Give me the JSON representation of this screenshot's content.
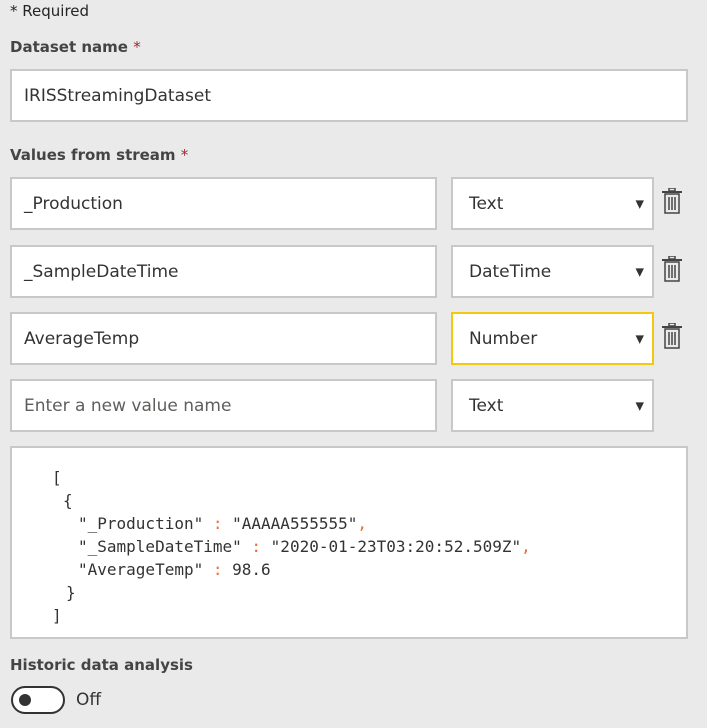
{
  "required_note": {
    "star": "*",
    "text": " Required"
  },
  "dataset": {
    "label": "Dataset name",
    "required_star": "*",
    "value": "IRISStreamingDataset"
  },
  "values_section": {
    "label": "Values from stream",
    "required_star": "*",
    "rows": [
      {
        "name": "_Production",
        "type": "Text",
        "deletable": true
      },
      {
        "name": "_SampleDateTime",
        "type": "DateTime",
        "deletable": true
      },
      {
        "name": "AverageTemp",
        "type": "Number",
        "deletable": true,
        "focused": true
      }
    ],
    "new_row": {
      "placeholder": "Enter a new value name",
      "type": "Text"
    }
  },
  "json_preview": {
    "open_bracket": "[",
    "open_brace": "{",
    "lines": [
      {
        "key": "\"_Production\"",
        "sep": " : ",
        "value": "\"AAAAA555555\"",
        "comma": ","
      },
      {
        "key": "\"_SampleDateTime\"",
        "sep": " : ",
        "value": "\"2020-01-23T03:20:52.509Z\"",
        "comma": ","
      },
      {
        "key": "\"AverageTemp\"",
        "sep": " : ",
        "value": "98.6",
        "comma": ""
      }
    ],
    "close_brace": "}",
    "close_bracket": "]"
  },
  "historic": {
    "label": "Historic data analysis",
    "toggle_state": "Off"
  },
  "colors": {
    "focus_border": "#f2c811",
    "punctuation": "#ec6c3c",
    "required_star": "#a4262c"
  }
}
